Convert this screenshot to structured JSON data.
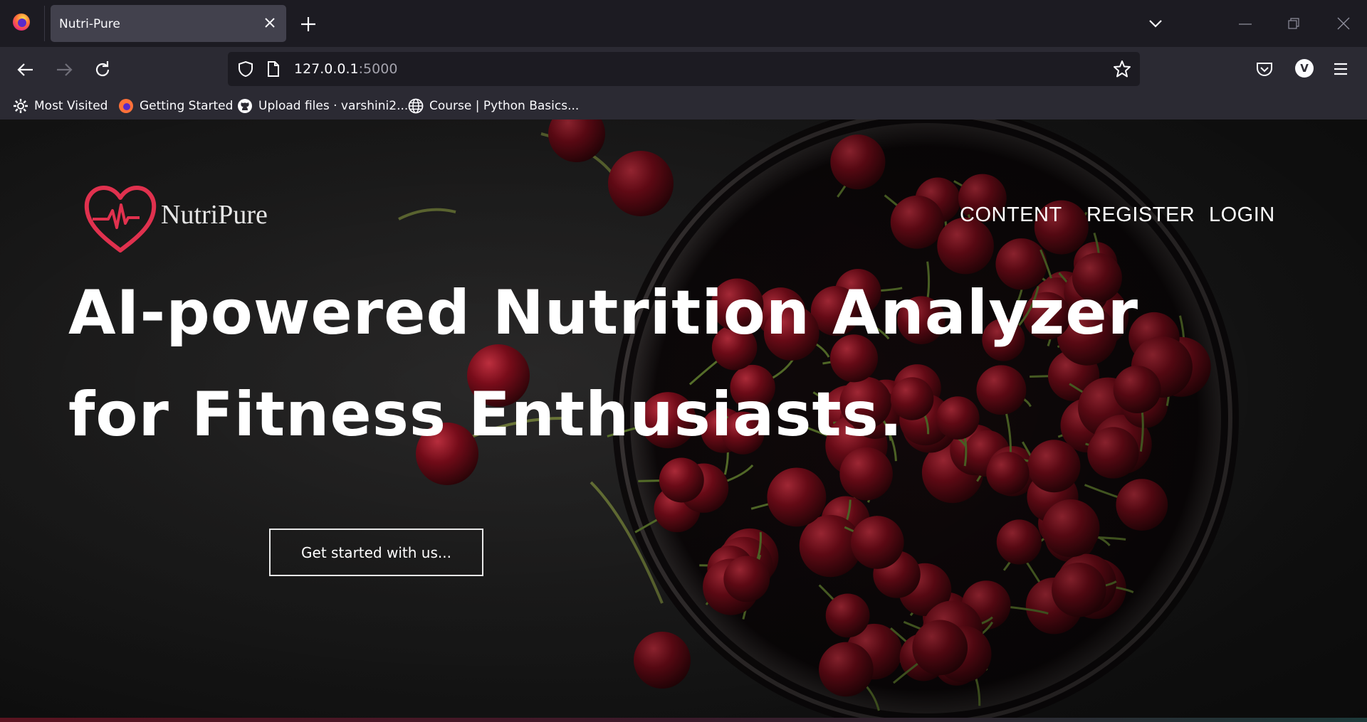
{
  "browser": {
    "tab_title": "Nutri-Pure",
    "url_host": "127.0.0.1",
    "url_port": ":5000",
    "profile_initial": "V",
    "bookmarks": [
      {
        "label": "Most Visited",
        "icon": "gear-icon"
      },
      {
        "label": "Getting Started",
        "icon": "firefox-icon"
      },
      {
        "label": "Upload files · varshini2...",
        "icon": "github-icon"
      },
      {
        "label": "Course | Python Basics...",
        "icon": "globe-icon"
      }
    ]
  },
  "site": {
    "brand": "NutriPure",
    "nav": [
      "CONTENT",
      "REGISTER",
      "LOGIN"
    ],
    "hero_line1": "AI-powered Nutrition Analyzer",
    "hero_line2": "for Fitness Enthusiasts.",
    "cta_label": "Get started with us..."
  },
  "colors": {
    "chrome_dark": "#1c1b22",
    "chrome_mid": "#2b2a33",
    "tab_active": "#42414d",
    "logo_red": "#e0314e",
    "cherry_red": "#7a0c1a"
  }
}
